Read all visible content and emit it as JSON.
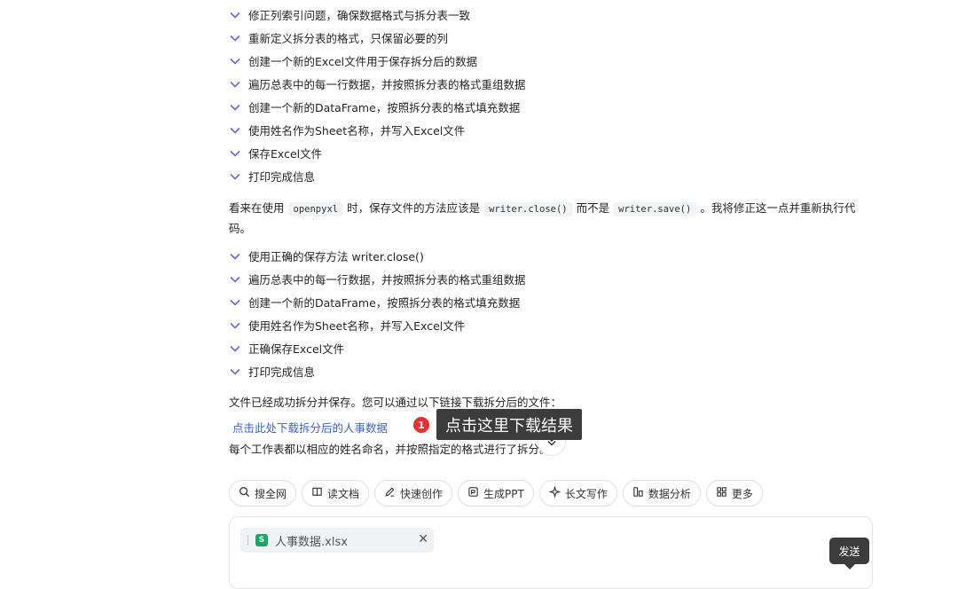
{
  "steps_group_1": [
    "修正列索引问题，确保数据格式与拆分表一致",
    "重新定义拆分表的格式，只保留必要的列",
    "创建一个新的Excel文件用于保存拆分后的数据",
    "遍历总表中的每一行数据，并按照拆分表的格式重组数据",
    "创建一个新的DataFrame，按照拆分表的格式填充数据",
    "使用姓名作为Sheet名称，并写入Excel文件",
    "保存Excel文件",
    "打印完成信息"
  ],
  "explanation": {
    "part1": "看来在使用",
    "code1": "openpyxl",
    "part2": "时，保存文件的方法应该是",
    "code2": "writer.close()",
    "part3": "而不是",
    "code3": "writer.save()",
    "part4": "。我将修正这一点并重新执行代码。"
  },
  "steps_group_2": [
    "使用正确的保存方法 writer.close()",
    "遍历总表中的每一行数据，并按照拆分表的格式重组数据",
    "创建一个新的DataFrame，按照拆分表的格式填充数据",
    "使用姓名作为Sheet名称，并写入Excel文件",
    "正确保存Excel文件",
    "打印完成信息"
  ],
  "result_text": "文件已经成功拆分并保存。您可以通过以下链接下载拆分后的文件：",
  "download_link": "点击此处下载拆分后的人事数据",
  "annotation": {
    "badge": "1",
    "tooltip": "点击这里下载结果"
  },
  "footer_text": "每个工作表都以相应的姓名命名，并按照指定的格式进行了拆分。",
  "toolbar": [
    {
      "icon": "search-icon",
      "label": "搜全网"
    },
    {
      "icon": "book-icon",
      "label": "读文档"
    },
    {
      "icon": "pen-icon",
      "label": "快速创作"
    },
    {
      "icon": "ppt-icon",
      "label": "生成PPT"
    },
    {
      "icon": "sparkle-icon",
      "label": "长文写作"
    },
    {
      "icon": "chart-icon",
      "label": "数据分析"
    },
    {
      "icon": "grid-icon",
      "label": "更多"
    }
  ],
  "attachment": {
    "icon_letter": "S",
    "name": "人事数据.xlsx"
  },
  "send_tooltip": "发送",
  "colors": {
    "check": "#7b5ce6",
    "link": "#3a63c8",
    "badge": "#e5322e",
    "tooltip_bg": "#3c3c3c",
    "xls": "#1fa463"
  }
}
